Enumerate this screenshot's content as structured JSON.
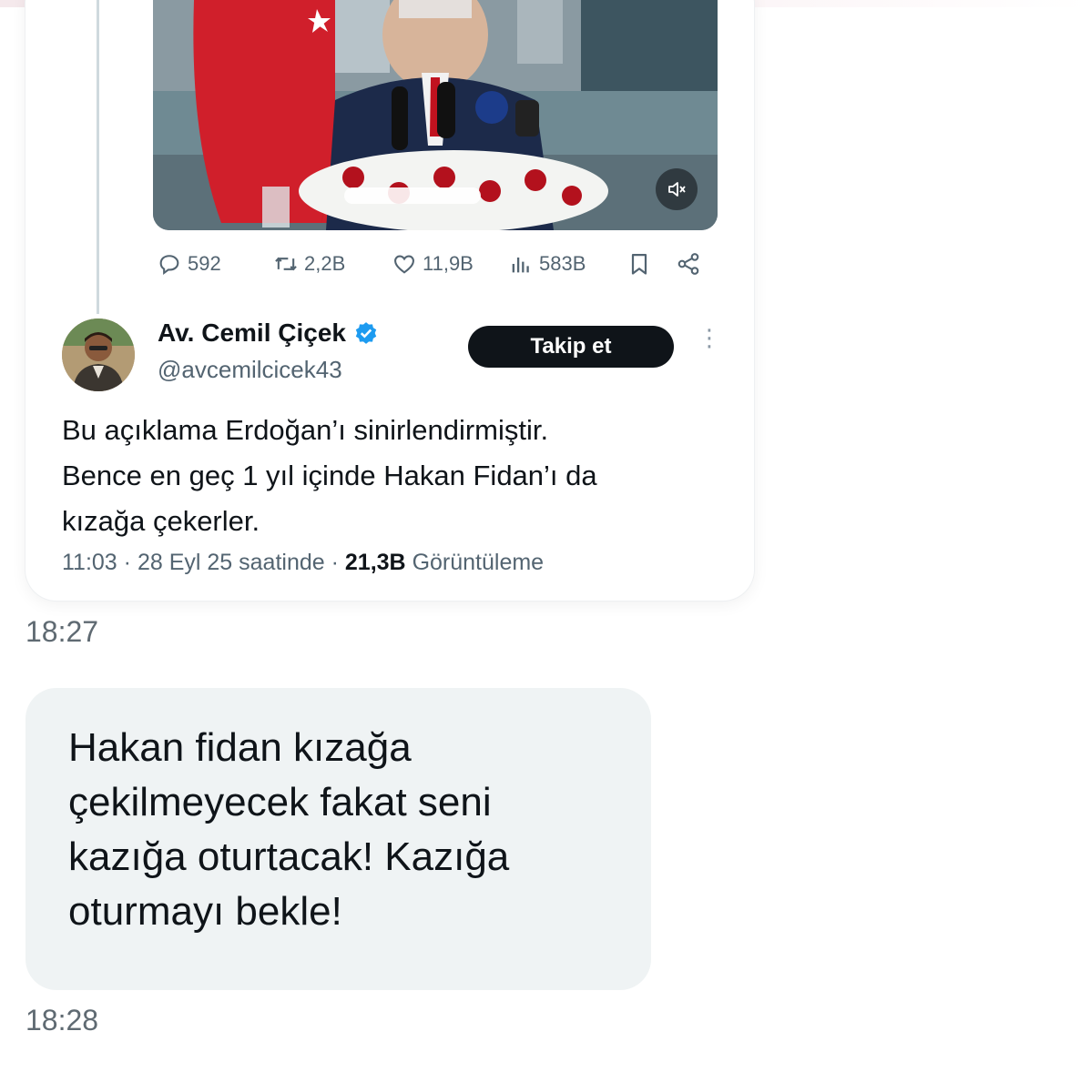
{
  "shared_tweet": {
    "video": {
      "mute_icon": "volume-mute-icon"
    },
    "actions": {
      "replies": "592",
      "retweets": "2,2B",
      "likes": "11,9B",
      "views": "583B"
    },
    "author": {
      "name": "Av. Cemil Çiçek",
      "handle": "@avcemilcicek43",
      "follow_label": "Takip et"
    },
    "text_lines": [
      "Bu açıklama Erdoğan’ı sinirlendirmiştir.",
      "Bence en geç 1 yıl içinde Hakan Fidan’ı da",
      "kızağa çekerler."
    ],
    "meta": {
      "time": "11:03",
      "date": "28 Eyl 25 saatinde",
      "views_count": "21,3B",
      "views_label": "Görüntüleme"
    }
  },
  "messages": [
    {
      "time": "18:27"
    },
    {
      "text_lines": [
        "Hakan fidan kızağa",
        "çekilmeyecek fakat seni",
        "kazığa oturtacak! Kazığa",
        "oturmayı bekle!"
      ],
      "time": "18:28"
    }
  ],
  "colors": {
    "bubble_bg": "#eff3f4",
    "muted_text": "#536471",
    "verified": "#1d9bf0",
    "follow_bg": "#0f1419"
  }
}
